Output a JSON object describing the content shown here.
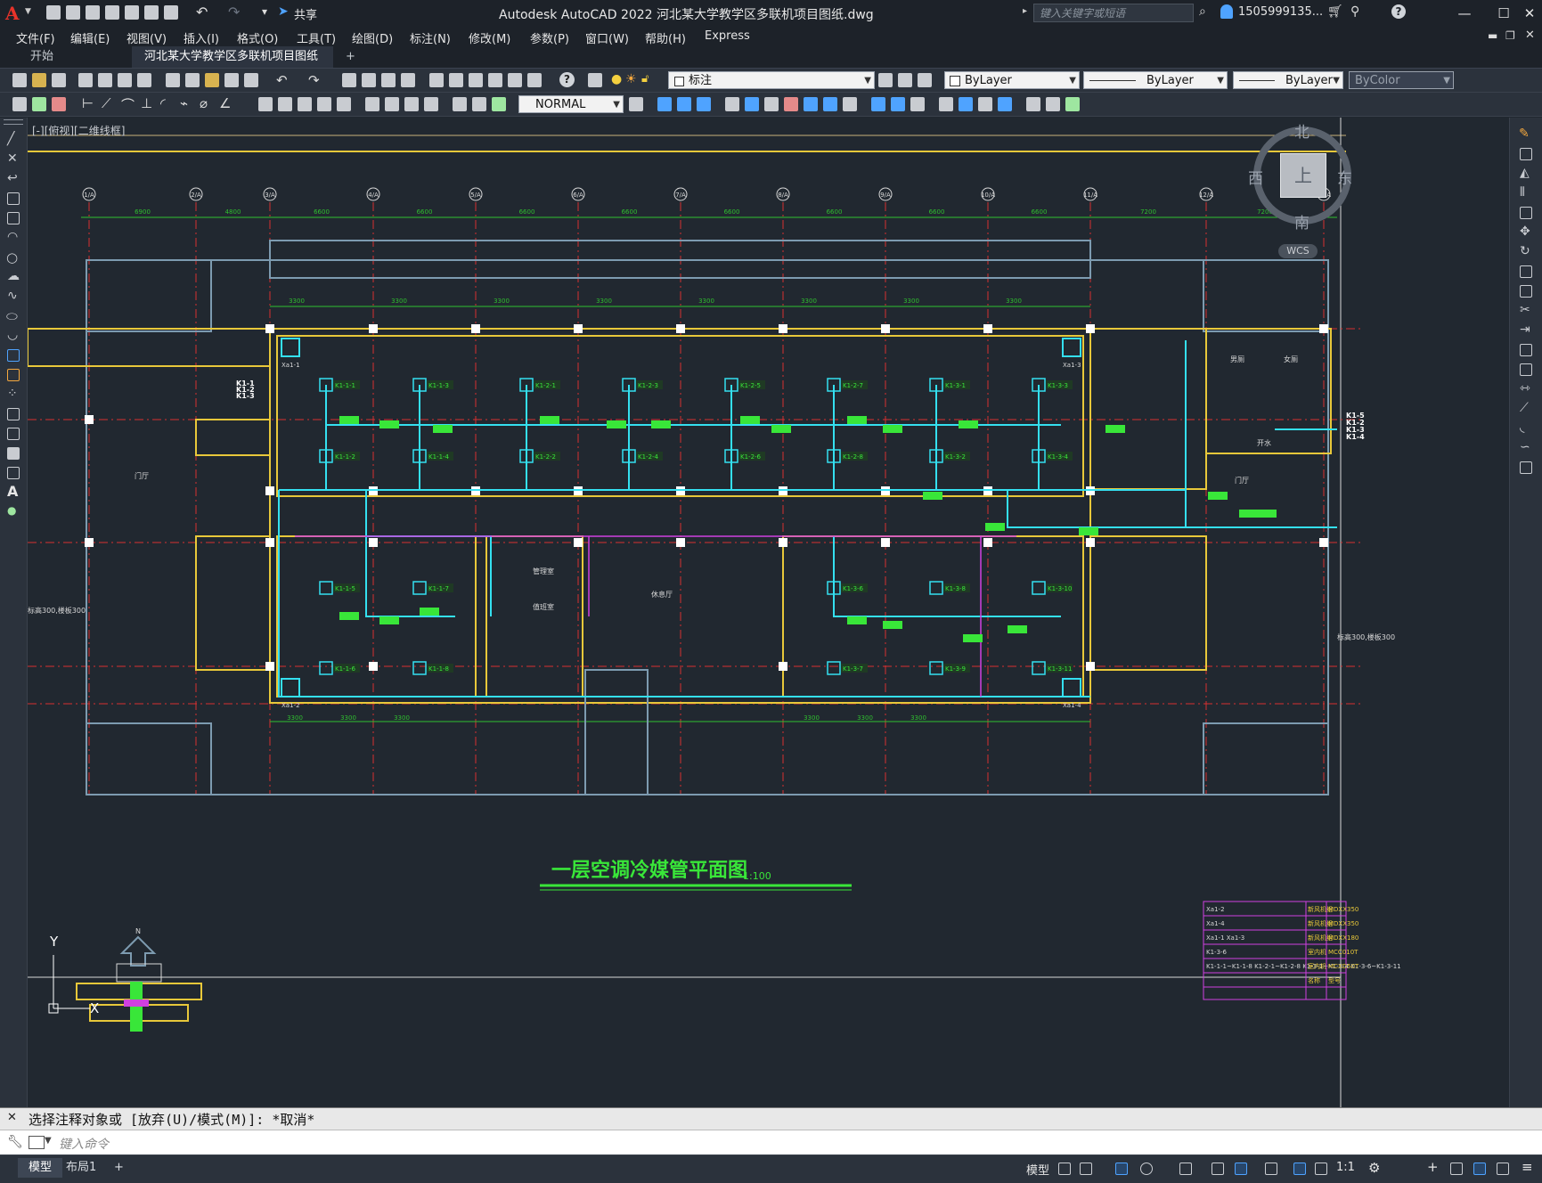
{
  "app": {
    "title": "Autodesk AutoCAD 2022    河北某大学教学区多联机项目图纸.dwg",
    "share_label": "共享"
  },
  "search": {
    "placeholder": "键入关键字或短语"
  },
  "user": {
    "name": "1505999135..."
  },
  "menu": [
    "文件(F)",
    "编辑(E)",
    "视图(V)",
    "插入(I)",
    "格式(O)",
    "工具(T)",
    "绘图(D)",
    "标注(N)",
    "修改(M)",
    "参数(P)",
    "窗口(W)",
    "帮助(H)",
    "Express"
  ],
  "tabs": {
    "start": "开始",
    "doc": "河北某大学教学区多联机项目图纸*",
    "close": "×",
    "new": "+"
  },
  "toolbar": {
    "layer_name": "标注",
    "color": "ByLayer",
    "linetype": "ByLayer",
    "lineweight": "ByLayer",
    "plotstyle": "ByColor",
    "textstyle": "NORMAL"
  },
  "viewport": {
    "label": "[-][俯视][二维线框]"
  },
  "viewcube": {
    "north": "北",
    "south": "南",
    "east": "东",
    "west": "西",
    "top": "上",
    "wcs": "WCS"
  },
  "drawing": {
    "title": "一层空调冷媒管平面图",
    "scale": "1:100",
    "compass": "N",
    "axis_y": "Y",
    "axis_x": "X",
    "grid_labels": [
      "1/A",
      "2/A",
      "3/A",
      "4/A",
      "5/A",
      "6/A",
      "7/A",
      "8/A",
      "9/A",
      "10/A",
      "11/A",
      "12/A",
      "13/A"
    ],
    "dims_top": [
      "6900",
      "4800",
      "6600",
      "6600",
      "6600",
      "6600",
      "6600",
      "6600",
      "6600",
      "6600",
      "7200",
      "7200"
    ],
    "dims_inner": [
      "3300",
      "3300",
      "3300",
      "3300",
      "3300",
      "3300",
      "3300",
      "3300",
      "3300",
      "3300",
      "3300",
      "3300",
      "3300",
      "3300"
    ],
    "units_top": [
      "K1-1-1",
      "K1-1-3",
      "K1-2-1",
      "K1-2-3",
      "K1-2-5",
      "K1-2-7",
      "K1-3-1",
      "K1-3-3"
    ],
    "units_mid": [
      "K1-1-2",
      "K1-1-4",
      "K1-2-2",
      "K1-2-4",
      "K1-2-6",
      "K1-2-8",
      "K1-3-2",
      "K1-3-4"
    ],
    "units_low1": [
      "K1-1-5",
      "K1-1-7",
      "K1-3-6",
      "K1-3-8",
      "K1-3-10"
    ],
    "units_low2": [
      "K1-1-6",
      "K1-1-8",
      "K1-3-7",
      "K1-3-9",
      "K1-3-11"
    ],
    "fresh_air": [
      "Xa1-1",
      "Xa1-2",
      "Xa1-3",
      "Xa1-4"
    ],
    "rooms": [
      "门厅",
      "门厅",
      "管理室",
      "值班室",
      "休息厅",
      "男厕",
      "女厕",
      "开水"
    ],
    "riser_labels": [
      "K1-1",
      "K1-2",
      "K1-3"
    ],
    "riser_labels_right": [
      "K1-5",
      "K1-2",
      "K1-3",
      "K1-4"
    ],
    "elev_note": "标高300,楼板300"
  },
  "legend_table": {
    "rows": [
      [
        "Xa1-2",
        "新风机组",
        "MDXX350"
      ],
      [
        "Xa1-4",
        "新风机组",
        "MDXX350"
      ],
      [
        "Xa1-1  Xa1-3",
        "新风机组",
        "MDXX180"
      ],
      [
        "K1-3-6",
        "室内机",
        "MCC010T"
      ],
      [
        "K1-1-1~K1-1-8  K1-2-1~K1-2-8  K1-3-1~K1-3-4  K1-3-6~K1-3-11",
        "室内机",
        "MCXD50T"
      ],
      [
        "",
        "名称",
        "型号"
      ]
    ]
  },
  "command": {
    "history": "选择注释对象或 [放弃(U)/模式(M)]: *取消*",
    "placeholder": "键入命令"
  },
  "status": {
    "model_tab": "模型",
    "layout_tab": "布局1",
    "add": "+",
    "model_btn": "模型",
    "scale": "1:1"
  },
  "colors": {
    "background": "#212830",
    "wall": "#e8c83a",
    "pipe": "#34e0f0",
    "grid": "#d83030",
    "dim": "#2fbf2f",
    "label_fill": "#39e639",
    "magenta": "#d040e0"
  }
}
